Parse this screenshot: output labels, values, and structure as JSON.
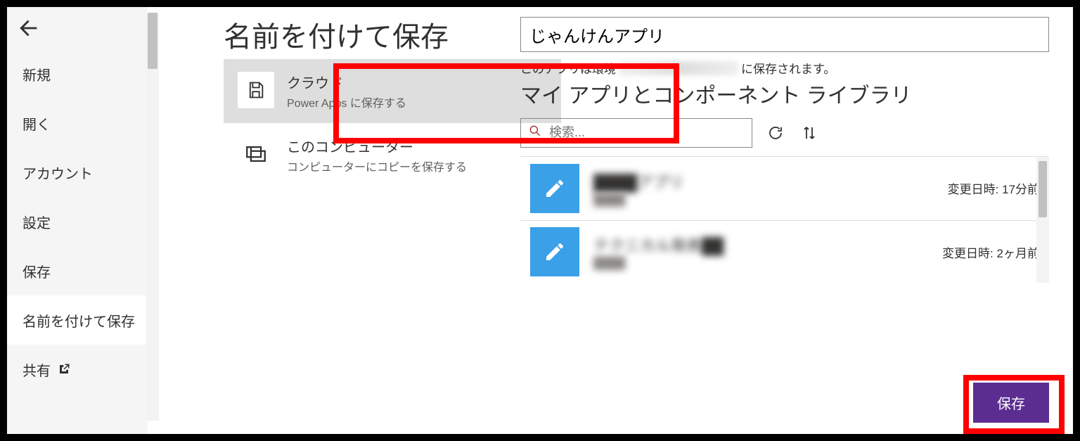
{
  "sidebar": {
    "items": [
      {
        "label": "新規"
      },
      {
        "label": "開く"
      },
      {
        "label": "アカウント"
      },
      {
        "label": "設定"
      },
      {
        "label": "保存"
      },
      {
        "label": "名前を付けて保存"
      },
      {
        "label": "共有"
      }
    ]
  },
  "page": {
    "title": "名前を付けて保存"
  },
  "locations": {
    "cloud": {
      "title": "クラウド",
      "subtitle": "Power Apps に保存する"
    },
    "computer": {
      "title": "このコンピューター",
      "subtitle": "コンピューターにコピーを保存する"
    }
  },
  "form": {
    "app_name": "じゃんけんアプリ",
    "env_prefix": "このアプリは環境",
    "env_suffix": "に保存されます。"
  },
  "section": {
    "title": "マイ アプリとコンポーネント ライブラリ"
  },
  "search": {
    "placeholder": "検索..."
  },
  "apps": [
    {
      "name": "████アプリ",
      "sub": "████",
      "date_label": "変更日時:",
      "date_value": "17分前"
    },
    {
      "name": "テクニカル発表██",
      "sub": "████",
      "date_label": "変更日時:",
      "date_value": "2ヶ月前"
    }
  ],
  "footer": {
    "save_label": "保存"
  }
}
